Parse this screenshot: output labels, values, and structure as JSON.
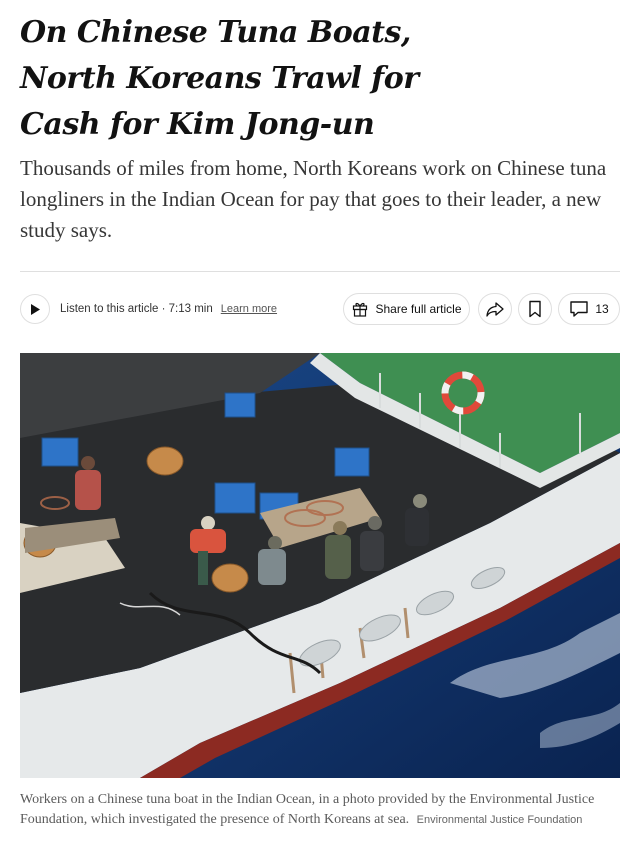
{
  "article": {
    "headline_lines": [
      "On Chinese Tuna Boats,",
      "North Koreans Trawl for",
      "Cash for Kim Jong-un"
    ],
    "summary": "Thousands of miles from home, North Koreans work on Chinese tuna longliners in the Indian Ocean for pay that goes to their leader, a new study says."
  },
  "toolbar": {
    "listen_label": "Listen to this article · 7:13 min",
    "learn_more": "Learn more",
    "share_full_label": "Share full article",
    "comments_count": "13",
    "icons": {
      "play": "play-icon",
      "gift": "gift-icon",
      "share": "share-arrow-icon",
      "bookmark": "bookmark-icon",
      "comment": "comment-icon"
    }
  },
  "media": {
    "caption": "Workers on a Chinese tuna boat in the Indian Ocean, in a photo provided by the Environmental Justice Foundation, which investigated the presence of North Koreans at sea.",
    "credit": "Environmental Justice Foundation"
  },
  "colors": {
    "text": "#121212",
    "summary_text": "#363636",
    "border": "#dfdfdf",
    "ocean": "#0f2f63",
    "deck_green": "#3f8f52",
    "hull": "#e6e9ea"
  }
}
